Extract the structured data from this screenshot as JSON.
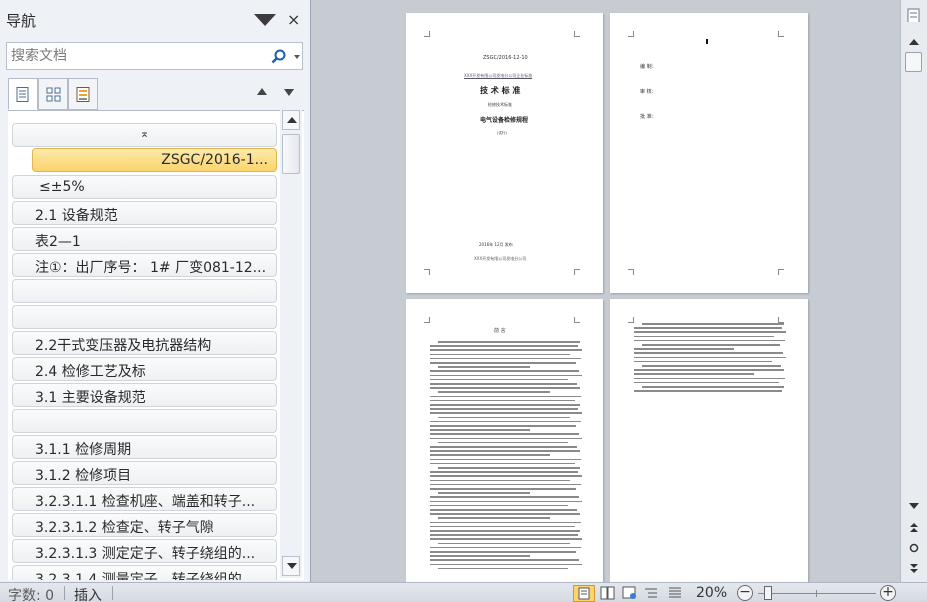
{
  "nav": {
    "title": "导航",
    "close_label": "×",
    "search_placeholder": "搜索文档",
    "view_tabs": [
      {
        "name": "headings-view",
        "icon": "document-outline-icon"
      },
      {
        "name": "pages-view",
        "icon": "page-thumbnails-icon"
      },
      {
        "name": "results-view",
        "icon": "search-results-icon"
      }
    ],
    "headings": [
      "⌅",
      "ZSGC/2016-1...",
      "≤±5%",
      "2.1 设备规范",
      "表2—1",
      "注①：出厂序号： 1# 厂变081-12...",
      "",
      "",
      "2.2干式变压器及电抗器结构",
      "2.4 检修工艺及标",
      "3.1 主要设备规范",
      "",
      "3.1.1 检修周期",
      "3.1.2 检修项目",
      "3.2.3.1.1 检查机座、端盖和转子...",
      "3.2.3.1.2 检查定、转子气隙",
      "3.2.3.1.3 测定定子、转子绕组的...",
      "3.2.3.1.4 测量定子、转子绕组的..."
    ],
    "selected_index": 1
  },
  "pages": {
    "p1": {
      "code": "ZSGC/2016-12-10",
      "org": "XXX开发有限公司发电分公司企业标准",
      "title": "技 术 标 准",
      "subtitle": "检修技术标准",
      "doc_title": "电气设备检修规程",
      "edition": "(试行)",
      "date": "2016年 12月   发布",
      "issuer": "XXX开发有限公司发电分公司"
    },
    "p2": {
      "rows": [
        "编    制：",
        "审    核：",
        "批    准："
      ]
    },
    "p3": {
      "heading": "前    言"
    }
  },
  "status": {
    "word_count": "字数: 0",
    "mode": "插入",
    "zoom": "20%",
    "zoom_minus": "−",
    "zoom_plus": "+",
    "zoom_level": 0.2
  },
  "colors": {
    "selected_heading": "#fbd46e",
    "panel_bg": "#eef1f6",
    "doc_bg": "#c7ccd3"
  }
}
